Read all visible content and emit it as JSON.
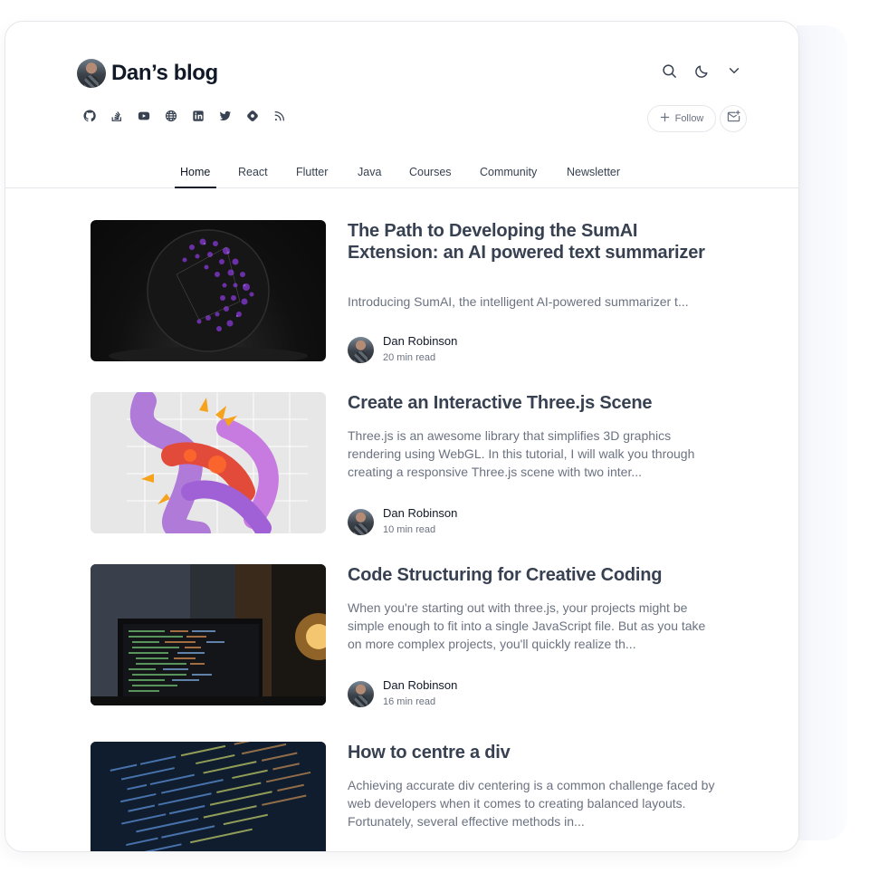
{
  "blog": {
    "title": "Dan’s blog"
  },
  "socials": [
    "github-icon",
    "stackoverflow-icon",
    "youtube-icon",
    "globe-icon",
    "linkedin-icon",
    "twitter-icon",
    "hashnode-icon",
    "rss-icon"
  ],
  "header": {
    "follow_label": "Follow"
  },
  "nav": {
    "tabs": [
      "Home",
      "React",
      "Flutter",
      "Java",
      "Courses",
      "Community",
      "Newsletter"
    ],
    "active": "Home"
  },
  "posts": [
    {
      "title": "The Path to Developing the SumAI Extension: an AI powered text summarizer",
      "excerpt": "Introducing SumAI, the intelligent AI-powered summarizer t...",
      "author": "Dan Robinson",
      "read_time": "20 min read"
    },
    {
      "title": "Create an Interactive Three.js Scene",
      "excerpt": "Three.js is an awesome library that simplifies 3D graphics rendering using WebGL. In this tutorial, I will walk you through creating a responsive Three.js scene with two inter...",
      "author": "Dan Robinson",
      "read_time": "10 min read"
    },
    {
      "title": "Code Structuring for Creative Coding",
      "excerpt": "When you're starting out with three.js, your projects might be simple enough to fit into a single JavaScript file. But as you take on more complex projects, you'll quickly realize th...",
      "author": "Dan Robinson",
      "read_time": "16 min read"
    },
    {
      "title": "How to centre a div",
      "excerpt": "Achieving accurate div centering is a common challenge faced by web developers when it comes to creating balanced layouts. Fortunately, several effective methods in..."
    }
  ]
}
